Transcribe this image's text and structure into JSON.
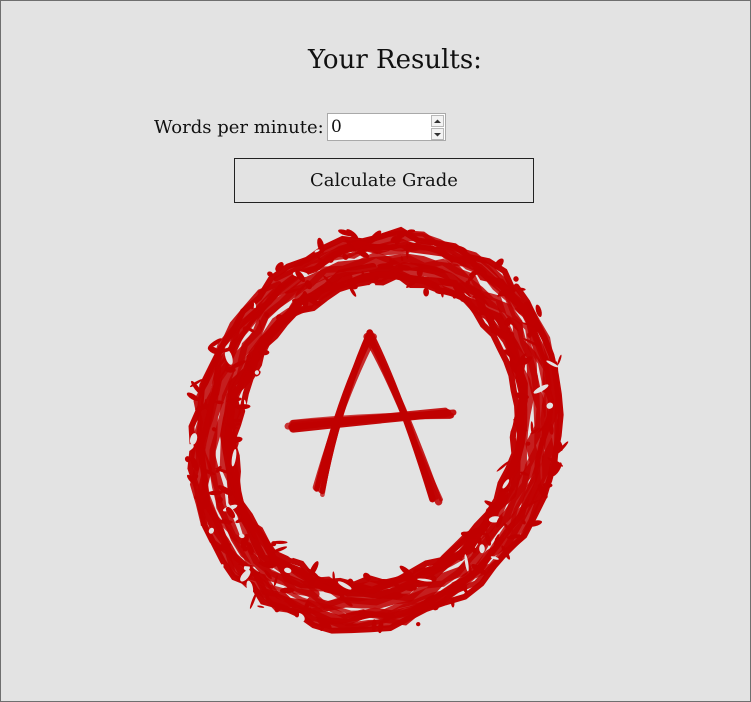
{
  "results": {
    "title": "Your Results:",
    "wpm_label": "Words per minute:",
    "wpm_value": "0",
    "calculate_label": "Calculate Grade"
  },
  "grade": {
    "letter": "A",
    "ink_color": "#c00000"
  },
  "colors": {
    "background": "#e3e3e3",
    "border": "#6f6f6f"
  },
  "icons": {
    "spin_up": "chevron-up-icon",
    "spin_down": "chevron-down-icon"
  }
}
